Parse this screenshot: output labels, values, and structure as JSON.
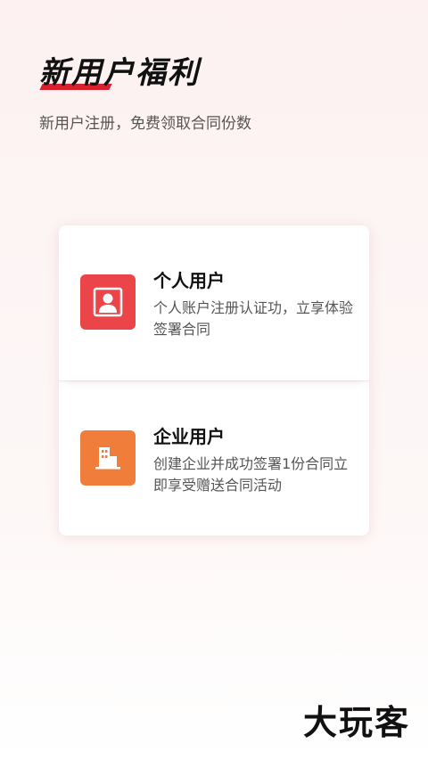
{
  "header": {
    "title": "新用户福利",
    "subtitle": "新用户注册，免费领取合同份数"
  },
  "cards": [
    {
      "title": "个人用户",
      "description": "个人账户注册认证功，立享体验签署合同",
      "icon": "person-icon",
      "color": "#ec4549"
    },
    {
      "title": "企业用户",
      "description": "创建企业并成功签署1份合同立即享受赠送合同活动",
      "icon": "building-icon",
      "color": "#f07d3a"
    }
  ],
  "watermark": {
    "text": "大玩客"
  },
  "colors": {
    "accent_red": "#d8202f"
  }
}
